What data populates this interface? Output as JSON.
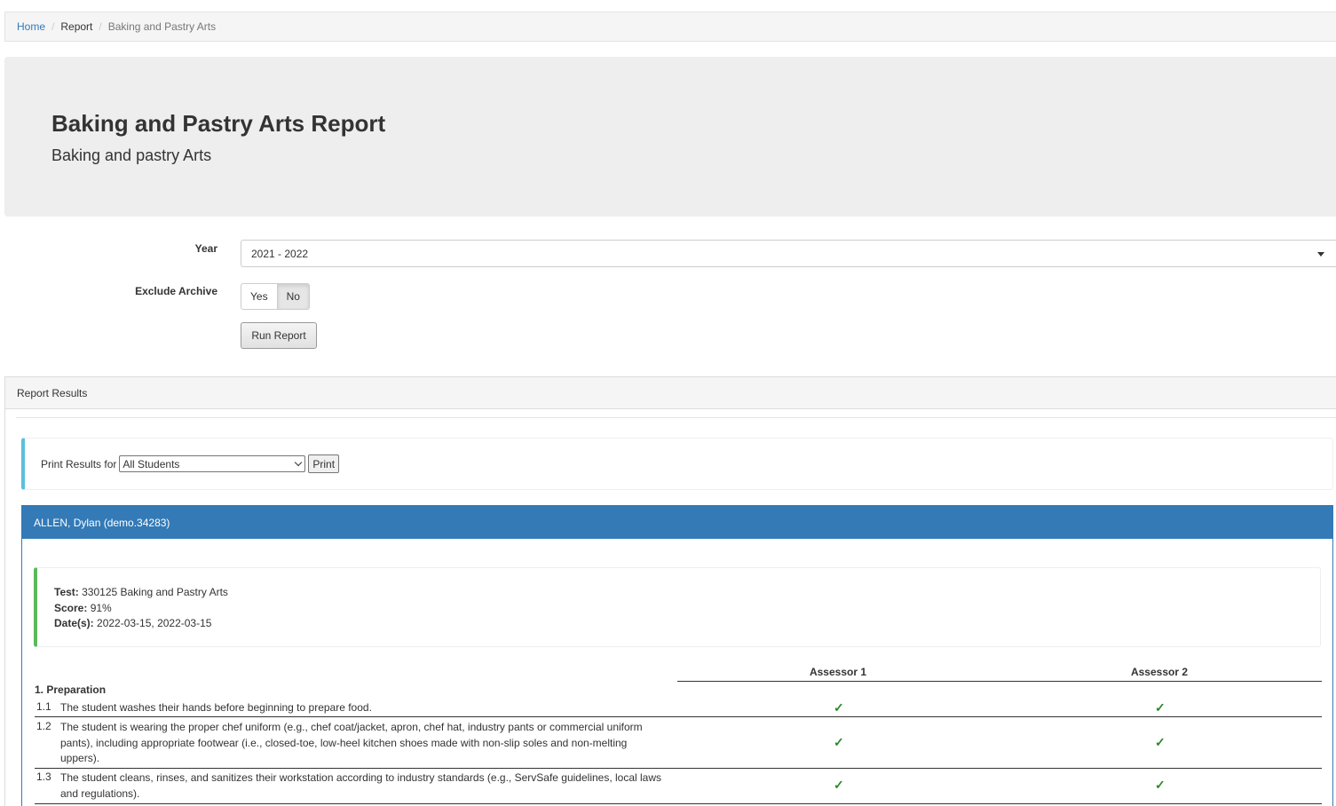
{
  "breadcrumb": {
    "home": "Home",
    "report": "Report",
    "current": "Baking and Pastry Arts"
  },
  "header": {
    "title": "Baking and Pastry Arts Report",
    "subtitle": "Baking and pastry Arts"
  },
  "form": {
    "year_label": "Year",
    "year_value": "2021 - 2022",
    "exclude_label": "Exclude Archive",
    "yes_label": "Yes",
    "no_label": "No",
    "selected_exclude": "No",
    "run_label": "Run Report"
  },
  "results": {
    "panel_title": "Report Results",
    "print_label": "Print Results for",
    "print_select_value": "All Students",
    "print_button": "Print"
  },
  "student": {
    "name": "ALLEN, Dylan (demo.34283)",
    "test_label": "Test:",
    "test_value": "330125 Baking and Pastry Arts",
    "score_label": "Score:",
    "score_value": "91%",
    "dates_label": "Date(s):",
    "dates_value": "2022-03-15, 2022-03-15"
  },
  "table": {
    "assessor1": "Assessor 1",
    "assessor2": "Assessor 2",
    "section": "1. Preparation",
    "check_glyph": "✓",
    "rows": [
      {
        "num": "1.1",
        "text": "The student washes their hands before beginning to prepare food."
      },
      {
        "num": "1.2",
        "text": "The student is wearing the proper chef uniform (e.g., chef coat/jacket, apron, chef hat, industry pants or commercial uniform pants), including appropriate footwear (i.e., closed-toe, low-heel kitchen shoes made with non-slip soles and non-melting uppers)."
      },
      {
        "num": "1.3",
        "text": "The student cleans, rinses, and sanitizes their workstation according to industry standards (e.g., ServSafe guidelines, local laws and regulations)."
      }
    ]
  },
  "colors": {
    "primary": "#337ab7",
    "info": "#5bc0de",
    "success": "#5cb85c",
    "check": "#2a8a2a"
  }
}
